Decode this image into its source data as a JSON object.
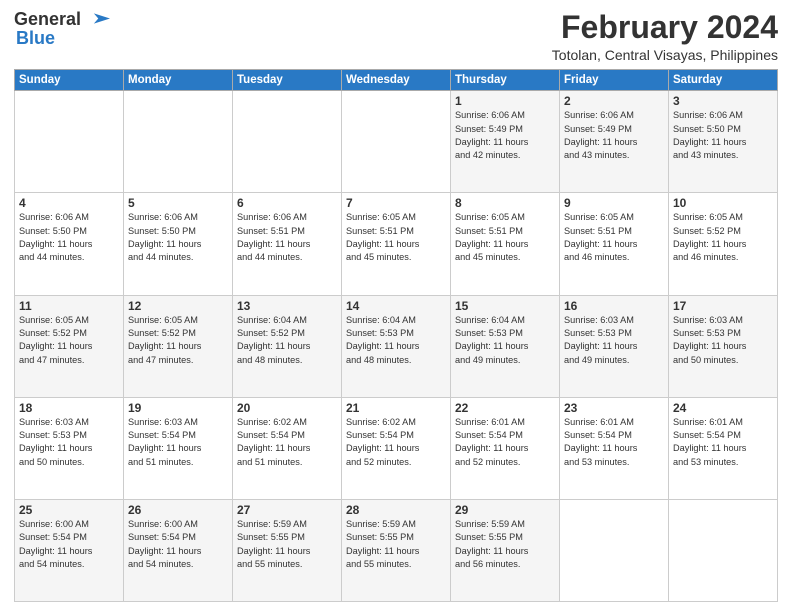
{
  "header": {
    "logo_line1": "General",
    "logo_line2": "Blue",
    "month_year": "February 2024",
    "location": "Totolan, Central Visayas, Philippines"
  },
  "weekdays": [
    "Sunday",
    "Monday",
    "Tuesday",
    "Wednesday",
    "Thursday",
    "Friday",
    "Saturday"
  ],
  "weeks": [
    [
      {
        "day": "",
        "info": ""
      },
      {
        "day": "",
        "info": ""
      },
      {
        "day": "",
        "info": ""
      },
      {
        "day": "",
        "info": ""
      },
      {
        "day": "1",
        "info": "Sunrise: 6:06 AM\nSunset: 5:49 PM\nDaylight: 11 hours\nand 42 minutes."
      },
      {
        "day": "2",
        "info": "Sunrise: 6:06 AM\nSunset: 5:49 PM\nDaylight: 11 hours\nand 43 minutes."
      },
      {
        "day": "3",
        "info": "Sunrise: 6:06 AM\nSunset: 5:50 PM\nDaylight: 11 hours\nand 43 minutes."
      }
    ],
    [
      {
        "day": "4",
        "info": "Sunrise: 6:06 AM\nSunset: 5:50 PM\nDaylight: 11 hours\nand 44 minutes."
      },
      {
        "day": "5",
        "info": "Sunrise: 6:06 AM\nSunset: 5:50 PM\nDaylight: 11 hours\nand 44 minutes."
      },
      {
        "day": "6",
        "info": "Sunrise: 6:06 AM\nSunset: 5:51 PM\nDaylight: 11 hours\nand 44 minutes."
      },
      {
        "day": "7",
        "info": "Sunrise: 6:05 AM\nSunset: 5:51 PM\nDaylight: 11 hours\nand 45 minutes."
      },
      {
        "day": "8",
        "info": "Sunrise: 6:05 AM\nSunset: 5:51 PM\nDaylight: 11 hours\nand 45 minutes."
      },
      {
        "day": "9",
        "info": "Sunrise: 6:05 AM\nSunset: 5:51 PM\nDaylight: 11 hours\nand 46 minutes."
      },
      {
        "day": "10",
        "info": "Sunrise: 6:05 AM\nSunset: 5:52 PM\nDaylight: 11 hours\nand 46 minutes."
      }
    ],
    [
      {
        "day": "11",
        "info": "Sunrise: 6:05 AM\nSunset: 5:52 PM\nDaylight: 11 hours\nand 47 minutes."
      },
      {
        "day": "12",
        "info": "Sunrise: 6:05 AM\nSunset: 5:52 PM\nDaylight: 11 hours\nand 47 minutes."
      },
      {
        "day": "13",
        "info": "Sunrise: 6:04 AM\nSunset: 5:52 PM\nDaylight: 11 hours\nand 48 minutes."
      },
      {
        "day": "14",
        "info": "Sunrise: 6:04 AM\nSunset: 5:53 PM\nDaylight: 11 hours\nand 48 minutes."
      },
      {
        "day": "15",
        "info": "Sunrise: 6:04 AM\nSunset: 5:53 PM\nDaylight: 11 hours\nand 49 minutes."
      },
      {
        "day": "16",
        "info": "Sunrise: 6:03 AM\nSunset: 5:53 PM\nDaylight: 11 hours\nand 49 minutes."
      },
      {
        "day": "17",
        "info": "Sunrise: 6:03 AM\nSunset: 5:53 PM\nDaylight: 11 hours\nand 50 minutes."
      }
    ],
    [
      {
        "day": "18",
        "info": "Sunrise: 6:03 AM\nSunset: 5:53 PM\nDaylight: 11 hours\nand 50 minutes."
      },
      {
        "day": "19",
        "info": "Sunrise: 6:03 AM\nSunset: 5:54 PM\nDaylight: 11 hours\nand 51 minutes."
      },
      {
        "day": "20",
        "info": "Sunrise: 6:02 AM\nSunset: 5:54 PM\nDaylight: 11 hours\nand 51 minutes."
      },
      {
        "day": "21",
        "info": "Sunrise: 6:02 AM\nSunset: 5:54 PM\nDaylight: 11 hours\nand 52 minutes."
      },
      {
        "day": "22",
        "info": "Sunrise: 6:01 AM\nSunset: 5:54 PM\nDaylight: 11 hours\nand 52 minutes."
      },
      {
        "day": "23",
        "info": "Sunrise: 6:01 AM\nSunset: 5:54 PM\nDaylight: 11 hours\nand 53 minutes."
      },
      {
        "day": "24",
        "info": "Sunrise: 6:01 AM\nSunset: 5:54 PM\nDaylight: 11 hours\nand 53 minutes."
      }
    ],
    [
      {
        "day": "25",
        "info": "Sunrise: 6:00 AM\nSunset: 5:54 PM\nDaylight: 11 hours\nand 54 minutes."
      },
      {
        "day": "26",
        "info": "Sunrise: 6:00 AM\nSunset: 5:54 PM\nDaylight: 11 hours\nand 54 minutes."
      },
      {
        "day": "27",
        "info": "Sunrise: 5:59 AM\nSunset: 5:55 PM\nDaylight: 11 hours\nand 55 minutes."
      },
      {
        "day": "28",
        "info": "Sunrise: 5:59 AM\nSunset: 5:55 PM\nDaylight: 11 hours\nand 55 minutes."
      },
      {
        "day": "29",
        "info": "Sunrise: 5:59 AM\nSunset: 5:55 PM\nDaylight: 11 hours\nand 56 minutes."
      },
      {
        "day": "",
        "info": ""
      },
      {
        "day": "",
        "info": ""
      }
    ]
  ]
}
